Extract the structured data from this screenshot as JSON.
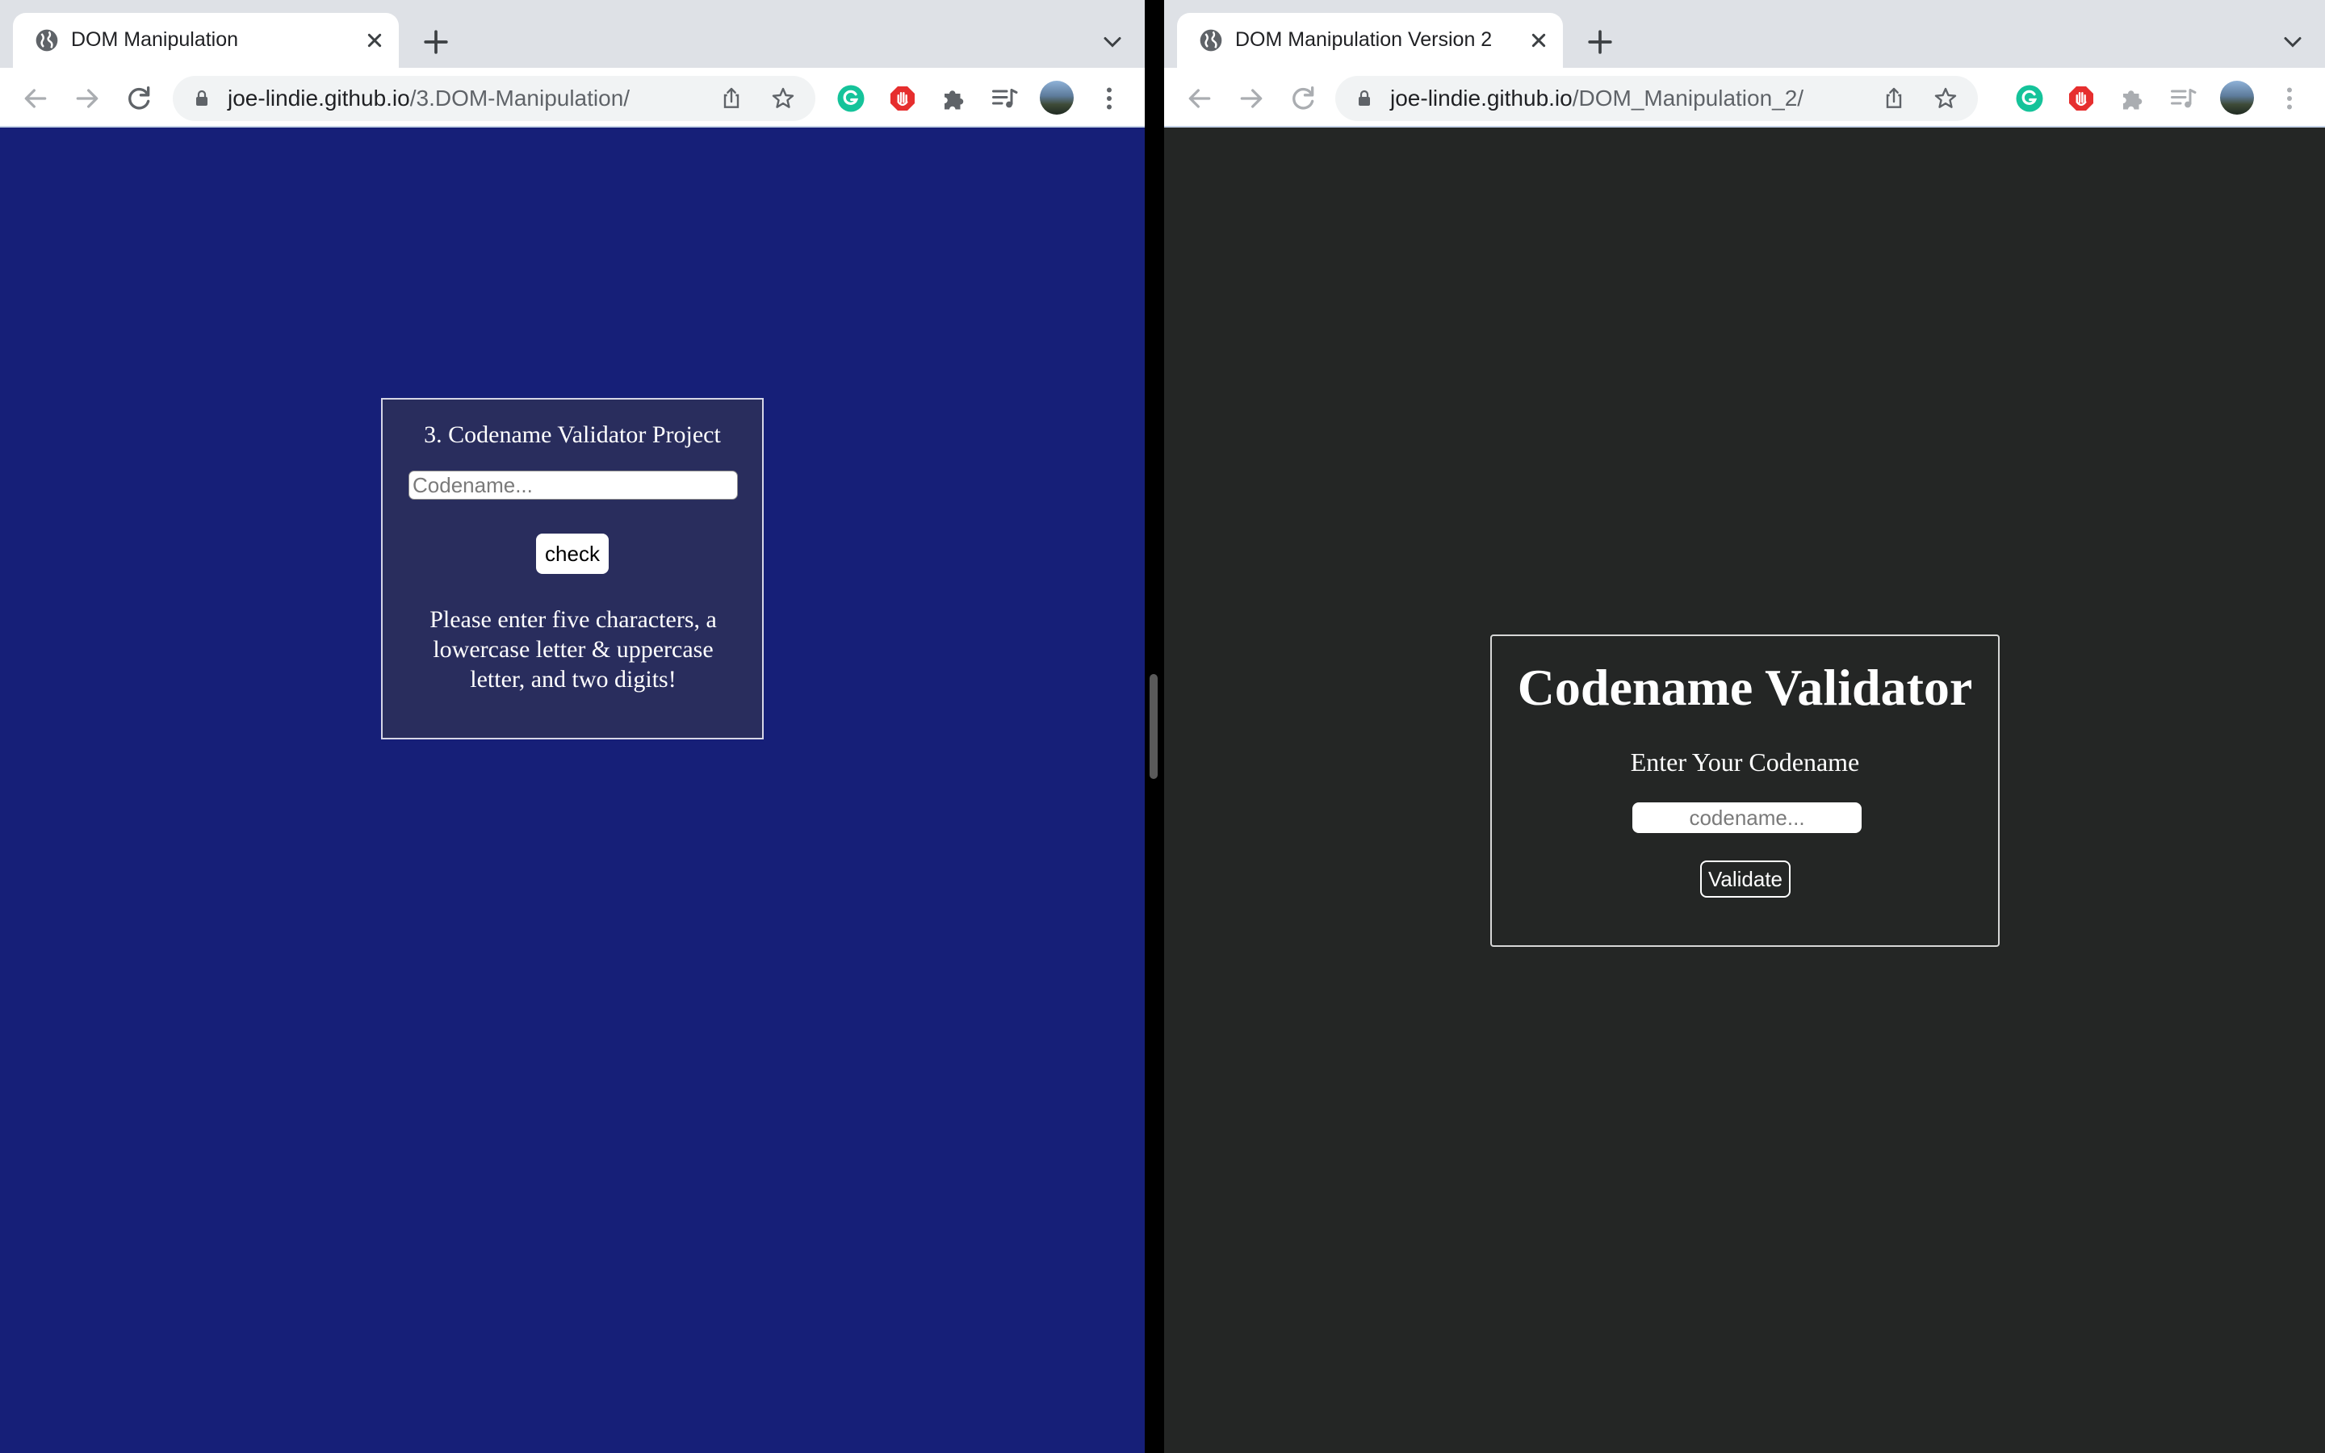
{
  "left": {
    "tab": {
      "title": "DOM Manipulation"
    },
    "omnibox": {
      "domain": "joe-lindie.github.io",
      "path": "/3.DOM-Manipulation/"
    },
    "page": {
      "heading": "3. Codename Validator Project",
      "input_placeholder": "Codename...",
      "input_value": "",
      "button_label": "check",
      "message": "Please enter five characters, a lowercase letter & uppercase letter, and two digits!"
    },
    "colors": {
      "background": "#161f78",
      "card": "#292d5d"
    }
  },
  "right": {
    "tab": {
      "title": "DOM Manipulation Version 2"
    },
    "omnibox": {
      "domain": "joe-lindie.github.io",
      "path": "/DOM_Manipulation_2/"
    },
    "page": {
      "heading": "Codename Validator",
      "subheading": "Enter Your Codename",
      "input_placeholder": "codename...",
      "input_value": "",
      "button_label": "Validate"
    },
    "colors": {
      "background": "#242625"
    }
  },
  "icons": {
    "favicon": "globe-icon",
    "tab_close": "close-icon",
    "new_tab": "plus-icon",
    "tab_search": "chevron-down-icon",
    "back": "arrow-left-icon",
    "forward": "arrow-right-icon",
    "reload": "reload-icon",
    "lock": "lock-icon",
    "share": "share-icon",
    "bookmark": "star-icon",
    "extensions": [
      "grammarly-icon",
      "adblock-icon",
      "puzzle-icon",
      "media-control-icon"
    ],
    "profile": "avatar",
    "menu": "kebab-menu-icon"
  }
}
